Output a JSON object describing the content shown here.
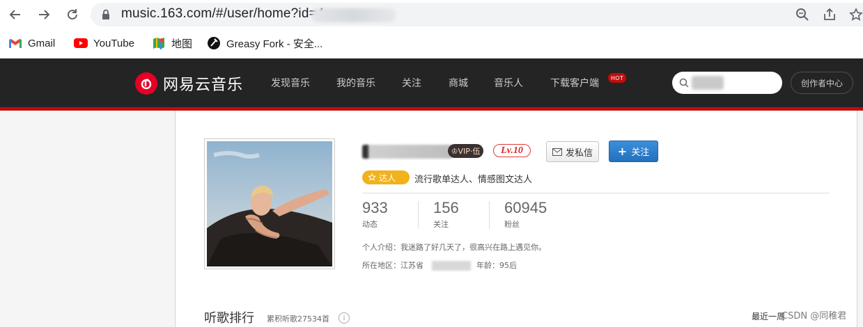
{
  "browser": {
    "url": "music.163.com/#/user/home?id=4",
    "back_icon": "arrow-left-icon",
    "forward_icon": "arrow-right-icon",
    "reload_icon": "reload-icon",
    "bookmarks": [
      {
        "label": "Gmail",
        "icon": "gmail-icon"
      },
      {
        "label": "YouTube",
        "icon": "youtube-icon"
      },
      {
        "label": "地图",
        "icon": "maps-icon"
      },
      {
        "label": "Greasy Fork - 安全...",
        "icon": "greasyfork-icon"
      }
    ]
  },
  "header": {
    "logo_text": "网易云音乐",
    "nav": [
      "发现音乐",
      "我的音乐",
      "关注",
      "商城",
      "音乐人",
      "下载客户端"
    ],
    "hot_badge": "HOT",
    "creator_center": "创作者中心",
    "accent_color": "#c20c0c"
  },
  "profile": {
    "vip_badge": "♔VIP·伍",
    "level": "Lv.10",
    "message_button": "发私信",
    "follow_button": "关注",
    "expert_badge": "达人",
    "expert_desc": "流行歌单达人、情感图文达人",
    "stats": [
      {
        "value": "933",
        "label": "动态"
      },
      {
        "value": "156",
        "label": "关注"
      },
      {
        "value": "60945",
        "label": "粉丝"
      }
    ],
    "intro": "个人介绍：我迷路了好几天了，很高兴在路上遇见你。",
    "location_label": "所在地区：江苏省",
    "age": "年龄：95后"
  },
  "ranking": {
    "title": "听歌排行",
    "subtitle": "累积听歌27534首",
    "recent_week": "最近一周",
    "watermark": "CSDN @同稚君"
  }
}
